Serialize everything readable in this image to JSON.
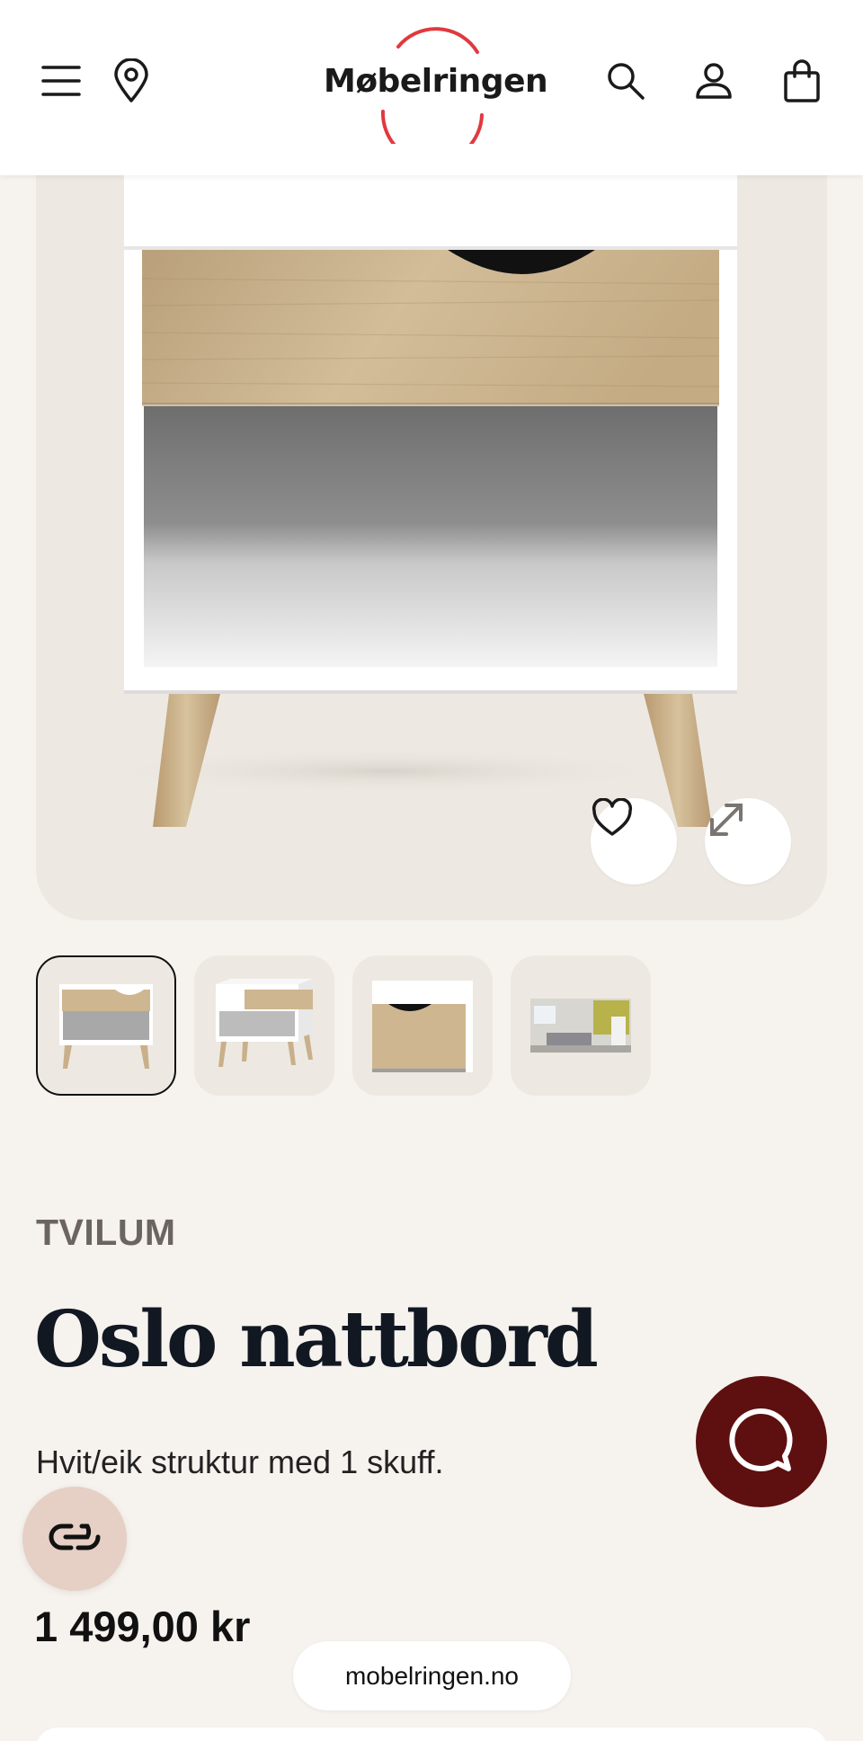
{
  "header": {
    "logo_text": "Møbelringen",
    "icons": [
      "menu-icon",
      "location-pin-icon",
      "search-icon",
      "account-icon",
      "shopping-bag-icon"
    ],
    "logo_color": "#e0393e"
  },
  "gallery": {
    "actions": [
      "heart-icon",
      "expand-icon"
    ],
    "thumbnail_count": 4,
    "active_thumbnail": 1
  },
  "product": {
    "brand": "TVILUM",
    "title": "Oslo nattbord",
    "description": "Hvit/eik struktur med 1 skuff.",
    "price": "1 499,00 kr"
  },
  "browser": {
    "url": "mobelringen.no"
  },
  "colors": {
    "page_bg": "#f6f2ee",
    "chat_button": "#5e0f0f",
    "loop_button": "#e6cfc5"
  }
}
